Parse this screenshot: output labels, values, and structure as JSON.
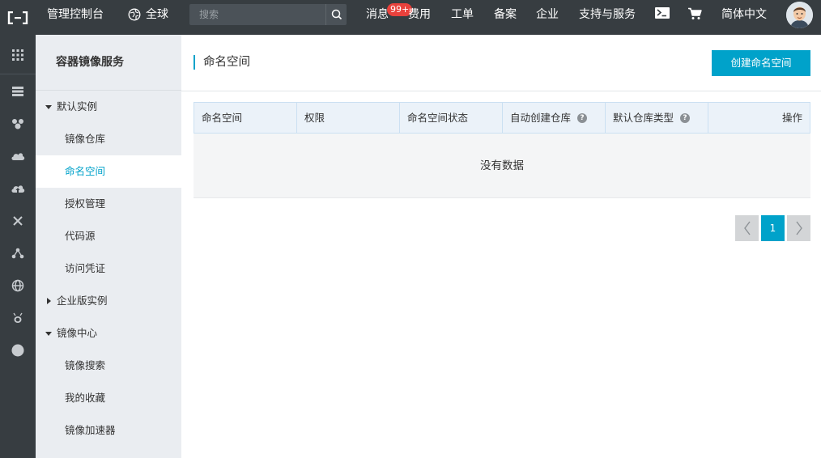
{
  "topbar": {
    "console_label": "管理控制台",
    "region_label": "全球",
    "search_placeholder": "搜索",
    "nav": [
      "消息",
      "费用",
      "工单",
      "备案",
      "企业",
      "支持与服务",
      "简体中文"
    ],
    "messages_badge": "99+"
  },
  "rail": {
    "icons": [
      "grid-icon",
      "server-icon",
      "cubes-icon",
      "cloud-icon",
      "cloud-upload-icon",
      "network-icon",
      "nodes-icon",
      "globe-icon",
      "bug-icon",
      "circle-icon"
    ]
  },
  "sidebar": {
    "title": "容器镜像服务",
    "group_default": "默认实例",
    "items_default": [
      "镜像仓库",
      "命名空间",
      "授权管理",
      "代码源",
      "访问凭证"
    ],
    "group_enterprise": "企业版实例",
    "group_center": "镜像中心",
    "items_center": [
      "镜像搜索",
      "我的收藏",
      "镜像加速器"
    ],
    "active": "命名空间"
  },
  "main": {
    "title": "命名空间",
    "create_button": "创建命名空间",
    "columns": [
      "命名空间",
      "权限",
      "命名空间状态",
      "自动创建仓库",
      "默认仓库类型",
      "操作"
    ],
    "empty_text": "没有数据",
    "help_glyph": "?",
    "pagination": {
      "current": "1"
    }
  },
  "colors": {
    "topbar_bg": "#373d41",
    "accent": "#00a2ca",
    "badge": "#e8413c",
    "sidebar_bg": "#eaedf1"
  }
}
